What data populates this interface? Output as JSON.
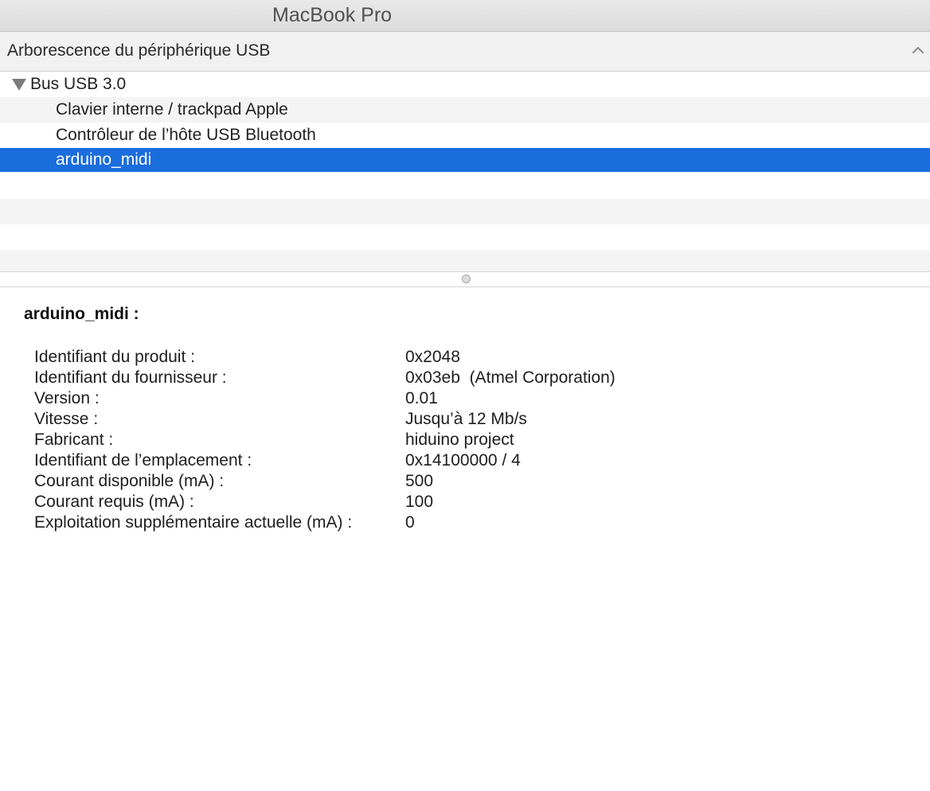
{
  "window": {
    "title": "MacBook Pro"
  },
  "section": {
    "title": "Arborescence du périphérique USB",
    "collapse_icon": "chevron-up-icon"
  },
  "tree": {
    "bus": {
      "label": "Bus USB 3.0",
      "expanded": true
    },
    "devices": [
      {
        "label": "Clavier interne / trackpad Apple",
        "selected": false
      },
      {
        "label": "Contrôleur de l’hôte USB Bluetooth",
        "selected": false
      },
      {
        "label": "arduino_midi",
        "selected": true
      }
    ]
  },
  "details": {
    "title": "arduino_midi :",
    "properties": [
      {
        "key": "Identifiant du produit :",
        "value": "0x2048"
      },
      {
        "key": "Identifiant du fournisseur :",
        "value": "0x03eb  (Atmel Corporation)"
      },
      {
        "key": "Version :",
        "value": "0.01"
      },
      {
        "key": "Vitesse :",
        "value": "Jusqu’à 12 Mb/s"
      },
      {
        "key": "Fabricant :",
        "value": "hiduino project"
      },
      {
        "key": "Identifiant de l’emplacement :",
        "value": "0x14100000 / 4"
      },
      {
        "key": "Courant disponible (mA) :",
        "value": "500"
      },
      {
        "key": "Courant requis (mA) :",
        "value": "100"
      },
      {
        "key": "Exploitation supplémentaire actuelle (mA) :",
        "value": "0"
      }
    ]
  },
  "colors": {
    "selection": "#1a6ddc",
    "alternate_row": "#f4f4f4"
  }
}
